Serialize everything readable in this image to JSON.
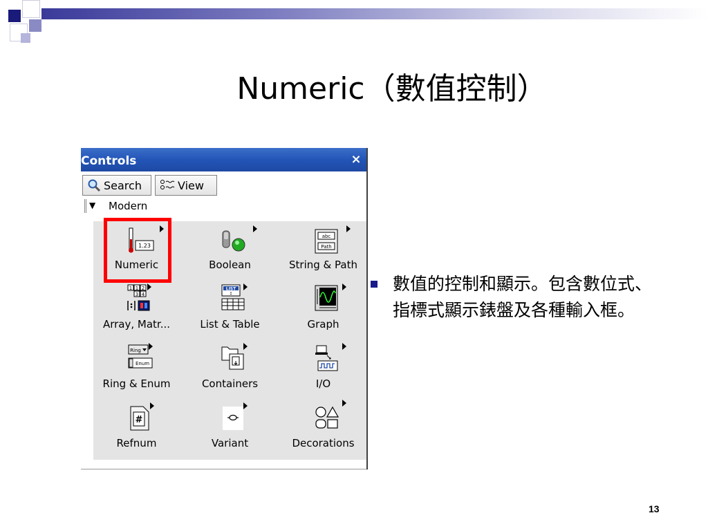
{
  "slide": {
    "title": "Numeric（數值控制）",
    "page_number": "13",
    "bullet": "數值的控制和顯示。包含數位式、指標式顯示錶盤及各種輸入框。"
  },
  "palette": {
    "window_title": "Controls",
    "close_glyph": "×",
    "toolbar": {
      "search_label": "Search",
      "view_label": "View"
    },
    "category_label": "Modern",
    "items": [
      {
        "label": "Numeric",
        "icon": "numeric-icon"
      },
      {
        "label": "Boolean",
        "icon": "boolean-icon"
      },
      {
        "label": "String & Path",
        "icon": "string-path-icon"
      },
      {
        "label": "Array, Matr...",
        "icon": "array-matrix-icon"
      },
      {
        "label": "List & Table",
        "icon": "list-table-icon"
      },
      {
        "label": "Graph",
        "icon": "graph-icon"
      },
      {
        "label": "Ring & Enum",
        "icon": "ring-enum-icon"
      },
      {
        "label": "Containers",
        "icon": "containers-icon"
      },
      {
        "label": "I/O",
        "icon": "io-icon"
      },
      {
        "label": "Refnum",
        "icon": "refnum-icon"
      },
      {
        "label": "Variant",
        "icon": "variant-icon"
      },
      {
        "label": "Decorations",
        "icon": "decorations-icon"
      }
    ],
    "icon_text": {
      "numeric_value": "1.23",
      "string_abc": "abc",
      "string_path": "Path",
      "list_tag": "LIST",
      "ring_tag": "Ring",
      "enum_tag": "Enum",
      "refnum_glyph": "#",
      "array_digits": [
        "1",
        "1",
        "2",
        "3",
        "4"
      ]
    },
    "highlight_color": "#ff0000",
    "titlebar_color": "#2355b7"
  }
}
